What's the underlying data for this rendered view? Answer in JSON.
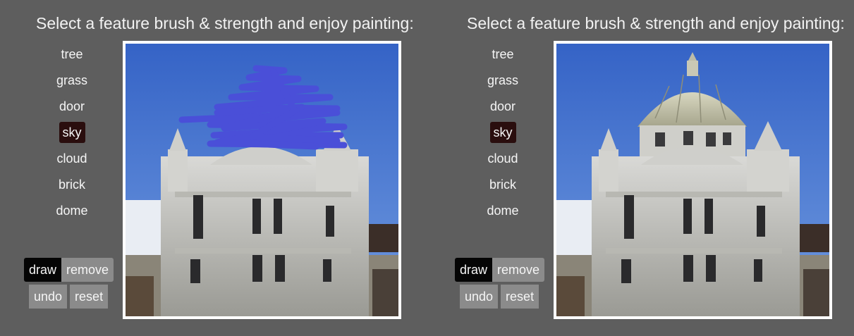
{
  "left_panel": {
    "instruction": "Select a feature brush & strength and enjoy painting:",
    "brushes": [
      "tree",
      "grass",
      "door",
      "sky",
      "cloud",
      "brick",
      "dome"
    ],
    "active_brush": "sky",
    "buttons": {
      "draw": "draw",
      "remove": "remove",
      "undo": "undo",
      "reset": "reset"
    },
    "active_mode": "draw"
  },
  "right_panel": {
    "instruction": "Select a feature brush & strength and enjoy painting:",
    "brushes": [
      "tree",
      "grass",
      "door",
      "sky",
      "cloud",
      "brick",
      "dome"
    ],
    "active_brush": "sky",
    "buttons": {
      "draw": "draw",
      "remove": "remove",
      "undo": "undo",
      "reset": "reset"
    },
    "active_mode": "draw"
  },
  "colors": {
    "background": "#5e5e5e",
    "active_brush_bg": "#2a0e0e",
    "draw_button_bg": "#050505",
    "secondary_button_bg": "#8b8b8b",
    "sky_blue": "#3c6fd0",
    "scribble": "#4a4fd8"
  },
  "canvas": {
    "left_content": "building-with-scribble",
    "right_content": "building-with-dome"
  }
}
